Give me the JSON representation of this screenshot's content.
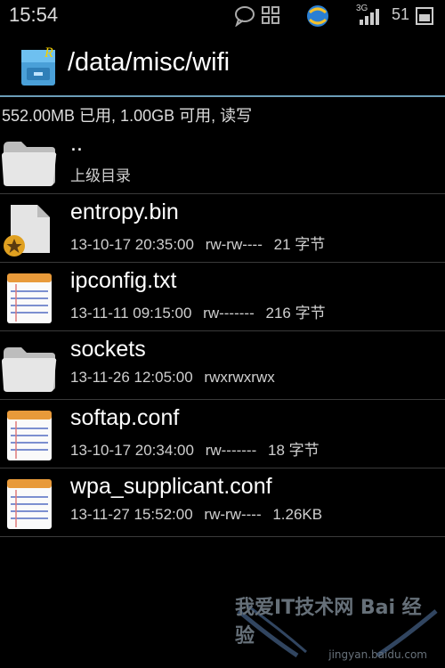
{
  "status_bar": {
    "time": "15:54",
    "network": "3G",
    "battery": "51",
    "icons": [
      "chat-bubble-icon",
      "grid-icon",
      "sync-globe-icon",
      "signal-icon",
      "battery-icon"
    ]
  },
  "header": {
    "app_icon": "file-manager-icon",
    "path": "/data/misc/wifi"
  },
  "storage": {
    "info": "552.00MB 已用, 1.00GB 可用, 读写"
  },
  "files": [
    {
      "icon": "folder-icon",
      "name": "..",
      "date": "上级目录",
      "perms": "",
      "size": ""
    },
    {
      "icon": "binary-file-icon",
      "name": "entropy.bin",
      "date": "13-10-17 20:35:00",
      "perms": "rw-rw----",
      "size": "21 字节"
    },
    {
      "icon": "text-file-icon",
      "name": "ipconfig.txt",
      "date": "13-11-11 09:15:00",
      "perms": "rw-------",
      "size": "216 字节"
    },
    {
      "icon": "folder-icon",
      "name": "sockets",
      "date": "13-11-26 12:05:00",
      "perms": "rwxrwxrwx",
      "size": ""
    },
    {
      "icon": "text-file-icon",
      "name": "softap.conf",
      "date": "13-10-17 20:34:00",
      "perms": "rw-------",
      "size": "18 字节"
    },
    {
      "icon": "text-file-icon",
      "name": "wpa_supplicant.conf",
      "date": "13-11-27 15:52:00",
      "perms": "rw-rw----",
      "size": "1.26KB"
    }
  ],
  "watermark": {
    "text": "我爱IT技术网 Bai 经验",
    "url": "jingyan.baidu.com"
  },
  "colors": {
    "background": "#000000",
    "divider": "#3a3a3a",
    "header_accent": "#6b9db8",
    "folder": "#d8d8d8",
    "note_lines": "#7c8fd0",
    "note_top": "#e89a3a"
  }
}
